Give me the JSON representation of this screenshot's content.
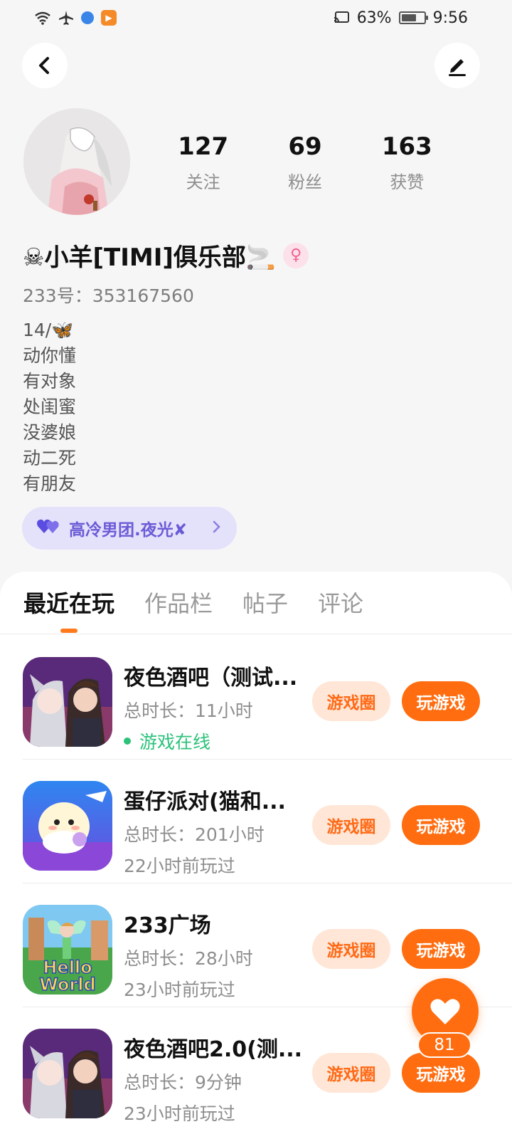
{
  "status_bar": {
    "battery_percent": "63%",
    "time": "9:56",
    "left_icons": [
      "wifi-icon",
      "airplane-icon",
      "browser-app-icon",
      "video-app-icon"
    ],
    "right_icons": [
      "cast-icon",
      "battery-icon"
    ]
  },
  "header": {
    "back_icon": "chevron-left-icon",
    "edit_icon": "pen-icon"
  },
  "profile": {
    "stats": [
      {
        "value": "127",
        "label": "关注"
      },
      {
        "value": "69",
        "label": "粉丝"
      },
      {
        "value": "163",
        "label": "获赞"
      }
    ],
    "nickname": "☠小羊[TIMI]俱乐部🚬",
    "gender": "♀",
    "user_id": "233号：353167560",
    "bio_lines": [
      "14/🦋",
      "动你懂",
      "有对象",
      "处闺蜜",
      "没婆娘",
      "动二死",
      "有朋友"
    ],
    "group": {
      "name": "高冷男团.夜光✘",
      "icon": "double-heart-icon"
    }
  },
  "tabs": [
    {
      "label": "最近在玩",
      "active": true
    },
    {
      "label": "作品栏",
      "active": false
    },
    {
      "label": "帖子",
      "active": false
    },
    {
      "label": "评论",
      "active": false
    }
  ],
  "games": [
    {
      "name": "夜色酒吧（测试...",
      "duration": "总时长：11小时",
      "status": "游戏在线",
      "online": true,
      "circle_label": "游戏圈",
      "play_label": "玩游戏"
    },
    {
      "name": "蛋仔派对(猫和...",
      "duration": "总时长：201小时",
      "status": "22小时前玩过",
      "online": false,
      "circle_label": "游戏圈",
      "play_label": "玩游戏"
    },
    {
      "name": "233广场",
      "duration": "总时长：28小时",
      "status": "23小时前玩过",
      "online": false,
      "circle_label": "游戏圈",
      "play_label": "玩游戏"
    },
    {
      "name": "夜色酒吧2.0(测...",
      "duration": "总时长：9分钟",
      "status": "23小时前玩过",
      "online": false,
      "circle_label": "游戏圈",
      "play_label": "玩游戏"
    }
  ],
  "floating_like": {
    "count": "81",
    "icon": "heart-icon"
  },
  "colors": {
    "accent": "#ff6d10",
    "accent_light": "#ffe6d6",
    "online": "#2cc27a",
    "group_bg": "#e4e1fb",
    "group_text": "#6a5bd6"
  }
}
